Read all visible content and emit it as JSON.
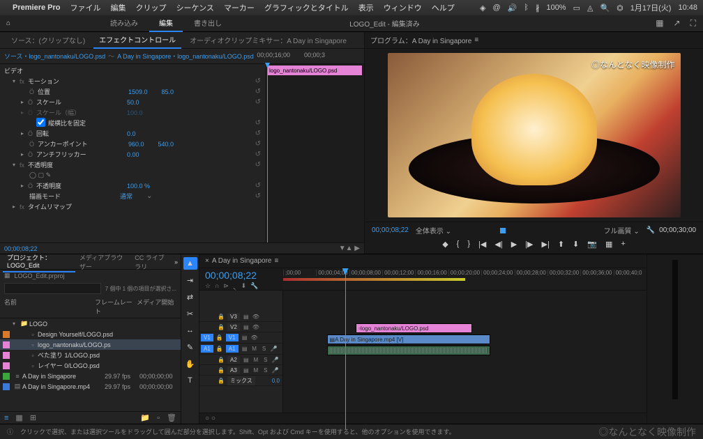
{
  "menubar": {
    "app": "Premiere Pro",
    "items": [
      "ファイル",
      "編集",
      "クリップ",
      "シーケンス",
      "マーカー",
      "グラフィックとタイトル",
      "表示",
      "ウィンドウ",
      "ヘルプ"
    ],
    "status": {
      "battery": "100%",
      "date": "1月17日(火)",
      "time": "10:48"
    }
  },
  "workspace": {
    "tabs": [
      "読み込み",
      "編集",
      "書き出し"
    ],
    "active": 1,
    "title": "LOGO_Edit - 編集済み"
  },
  "source_tabs": {
    "source": "ソース：(クリップなし)",
    "effect": "エフェクトコントロール",
    "mixer": "オーディオクリップミキサー：A Day in Singapore"
  },
  "effect": {
    "src": "ソース・logo_nantonaku/LOGO.psd",
    "seq": "A Day in Singapore・logo_nantonaku/LOGO.psd",
    "tc1": "00;00;16;00",
    "tc2": "00;00;3",
    "clip_label": "logo_nantonaku/LOGO.psd",
    "video_label": "ビデオ",
    "motion": "モーション",
    "position": "位置",
    "position_x": "1509.0",
    "position_y": "85.0",
    "scale": "スケール",
    "scale_val": "50.0",
    "scale_w": "スケール（幅）",
    "scale_w_val": "100.0",
    "aspect_lock": "縦横比を固定",
    "rotation": "回転",
    "rotation_val": "0.0",
    "anchor": "アンカーポイント",
    "anchor_x": "960.0",
    "anchor_y": "540.0",
    "antiflicker": "アンチフリッカー",
    "antiflicker_val": "0.00",
    "opacity_grp": "不透明度",
    "opacity": "不透明度",
    "opacity_val": "100.0 %",
    "blend": "描画モード",
    "blend_val": "通常",
    "timeremap": "タイムリマップ",
    "footer_tc": "00;00;08;22"
  },
  "program": {
    "title": "プログラム：A Day in Singapore",
    "overlay": "◎なんとなく映像制作",
    "tc_left": "00;00;08;22",
    "fit": "全体表示",
    "quality": "フル画質",
    "tc_right": "00;00;30;00"
  },
  "project": {
    "tabs": [
      "プロジェクト：LOGO_Edit",
      "メディアブラウザー",
      "CC ライブラリ"
    ],
    "file": "LOGO_Edit.prproj",
    "selection": "7 個中 1 個の項目が選択さ...",
    "cols": {
      "name": "名前",
      "fr": "フレームレート",
      "media": "メディア開始"
    },
    "items": [
      {
        "swatch": "",
        "type": "folder",
        "name": "LOGO"
      },
      {
        "swatch": "sw-orange",
        "type": "psd",
        "name": "Design Yourself/LOGO.psd"
      },
      {
        "swatch": "sw-pink",
        "type": "psd",
        "name": "logo_nantonaku/LOGO.ps",
        "selected": true
      },
      {
        "swatch": "sw-pink",
        "type": "psd",
        "name": "べた塗り 1/LOGO.psd"
      },
      {
        "swatch": "sw-pink",
        "type": "psd",
        "name": "レイヤー 0/LOGO.psd"
      },
      {
        "swatch": "sw-green",
        "type": "seq",
        "name": "A Day in Singapore",
        "fr": "29.97 fps",
        "mb": "00;00;00;00"
      },
      {
        "swatch": "sw-blue",
        "type": "mov",
        "name": "A Day in Singapore.mp4",
        "fr": "29.97 fps",
        "mb": "00;00;00;00"
      }
    ]
  },
  "timeline": {
    "title": "A Day in Singapore",
    "tc": "00;00;08;22",
    "marks": [
      ";00;00",
      "00;00;04;00",
      "00;00;08;00",
      "00;00;12;00",
      "00;00;16;00",
      "00;00;20;00",
      "00;00;24;00",
      "00;00;28;00",
      "00;00;32;00",
      "00;00;36;00",
      "00;00;40;0"
    ],
    "tracks": {
      "v3": "V3",
      "v2": "V2",
      "v1": "V1",
      "a1": "A1",
      "a2": "A2",
      "a3": "A3",
      "mix": "ミックス",
      "mix_val": "0.0"
    },
    "clip_pink": "logo_nantonaku/LOGO.psd",
    "clip_blue": "A Day in Singapore.mp4 [V]"
  },
  "footer": {
    "hint": "クリックで選択、または選択ツールをドラッグして囲んだ部分を選択します。Shift、Opt および Cmd キーを使用すると、他のオプションを使用できます。",
    "watermark": "◎なんとなく映像制作"
  }
}
